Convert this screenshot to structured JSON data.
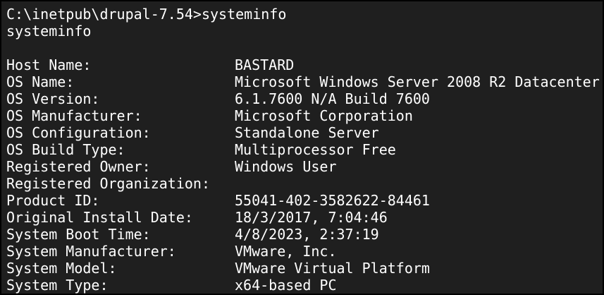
{
  "terminal": {
    "prompt_line": "C:\\inetpub\\drupal-7.54>systeminfo",
    "echo_line": "systeminfo",
    "rows": [
      {
        "key": "Host Name:",
        "value": "BASTARD"
      },
      {
        "key": "OS Name:",
        "value": "Microsoft Windows Server 2008 R2 Datacenter"
      },
      {
        "key": "OS Version:",
        "value": "6.1.7600 N/A Build 7600"
      },
      {
        "key": "OS Manufacturer:",
        "value": "Microsoft Corporation"
      },
      {
        "key": "OS Configuration:",
        "value": "Standalone Server"
      },
      {
        "key": "OS Build Type:",
        "value": "Multiprocessor Free"
      },
      {
        "key": "Registered Owner:",
        "value": "Windows User"
      },
      {
        "key": "Registered Organization:",
        "value": ""
      },
      {
        "key": "Product ID:",
        "value": "55041-402-3582622-84461"
      },
      {
        "key": "Original Install Date:",
        "value": "18/3/2017, 7:04:46"
      },
      {
        "key": "System Boot Time:",
        "value": "4/8/2023, 2:37:19"
      },
      {
        "key": "System Manufacturer:",
        "value": "VMware, Inc."
      },
      {
        "key": "System Model:",
        "value": "VMware Virtual Platform"
      },
      {
        "key": "System Type:",
        "value": "x64-based PC"
      }
    ]
  },
  "colors": {
    "background": "#1f1f1f",
    "text": "#ffffff",
    "border": "#000000"
  }
}
